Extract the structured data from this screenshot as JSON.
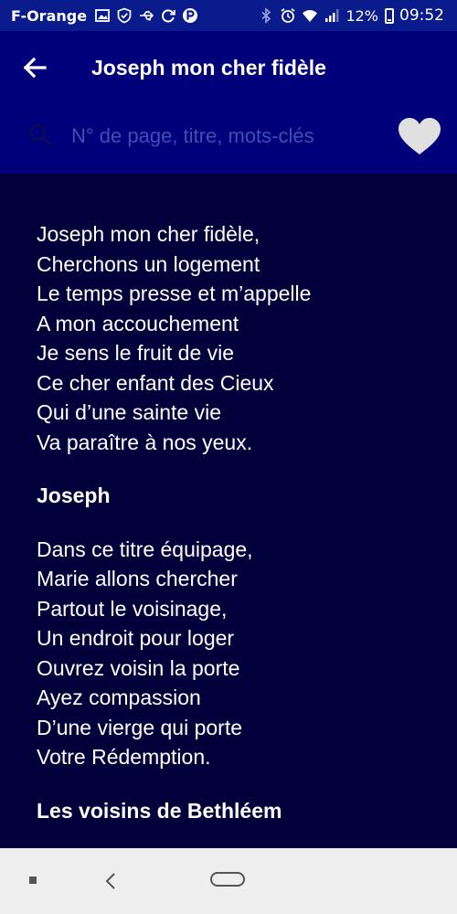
{
  "status_bar": {
    "carrier": "F-Orange",
    "battery": "12%",
    "battery_level": 0.12,
    "time": "09:52"
  },
  "header": {
    "title": "Joseph mon cher fidèle",
    "back_icon": "arrow-left-icon",
    "favorite_icon": "heart-icon"
  },
  "search": {
    "placeholder": "N° de page, titre, mots-clés",
    "value": ""
  },
  "content": {
    "stanza1": [
      "Joseph mon cher fidèle,",
      "Cherchons un logement",
      "Le temps presse et m’appelle",
      "A mon accouchement",
      "Je sens le fruit de vie",
      "Ce cher enfant des Cieux",
      "Qui d’une sainte vie",
      "Va paraître à nos yeux."
    ],
    "speaker1": "Joseph",
    "stanza2": [
      "Dans ce titre équipage,",
      "Marie allons chercher",
      "Partout le voisinage,",
      "Un endroit pour loger",
      "Ouvrez voisin la porte",
      "Ayez compassion",
      "D’une vierge qui porte",
      "Votre Rédemption."
    ],
    "speaker2": "Les voisins de Bethléem"
  },
  "colors": {
    "status_bar": "#0a1c8c",
    "header": "#00007a",
    "background": "#00003a",
    "placeholder": "#3e4fb4",
    "heart": "#e0e0e0",
    "nav_bar": "#eeeeee"
  }
}
